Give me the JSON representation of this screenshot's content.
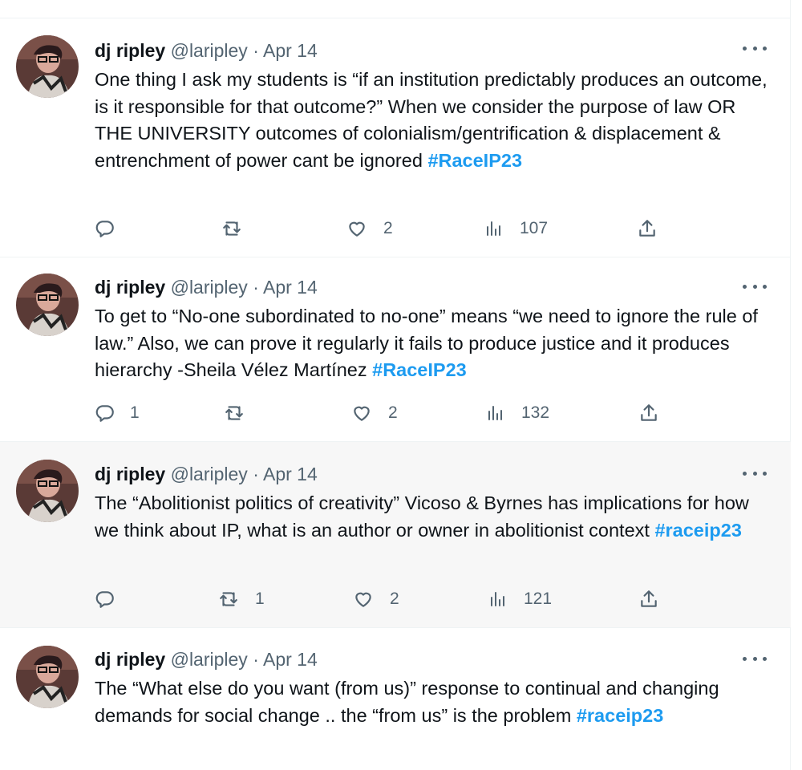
{
  "tweets": [
    {
      "name": "dj ripley",
      "handle": "@laripley",
      "dot": "·",
      "date": "Apr 14",
      "text": "One thing I ask my students is “if an institution predictably produces an outcome, is it responsible for that outcome?” When we consider the purpose of law OR THE UNIVERSITY outcomes of colonialism/gentrification & displacement & entrenchment of power cant be ignored ",
      "hashtag": "#RaceIP23",
      "replies": "",
      "retweets": "",
      "likes": "2",
      "views": "107"
    },
    {
      "name": "dj ripley",
      "handle": "@laripley",
      "dot": "·",
      "date": "Apr 14",
      "text": "To get to “No-one subordinated to no-one” means “we need to ignore the rule of law.” Also, we can prove it regularly it fails to produce justice and it produces hierarchy -Sheila Vélez Martínez ",
      "hashtag": "#RaceIP23",
      "replies": "1",
      "retweets": "",
      "likes": "2",
      "views": "132"
    },
    {
      "name": "dj ripley",
      "handle": "@laripley",
      "dot": "·",
      "date": "Apr 14",
      "text": "The “Abolitionist politics of creativity” Vicoso & Byrnes has implications for how we think about IP, what is an author or owner in abolitionist context ",
      "hashtag": "#raceip23",
      "replies": "",
      "retweets": "1",
      "likes": "2",
      "views": "121"
    },
    {
      "name": "dj ripley",
      "handle": "@laripley",
      "dot": "·",
      "date": "Apr 14",
      "text": "The “What else do you want (from us)” response to continual and changing demands for social change .. the “from us” is the problem ",
      "hashtag": "#raceip23"
    }
  ],
  "icons": {
    "reply": "reply-icon",
    "retweet": "retweet-icon",
    "like": "heart-icon",
    "views": "views-icon",
    "share": "share-icon",
    "more": "more-icon"
  },
  "colors": {
    "hashtag": "#1d9bf0",
    "secondary_text": "#536471",
    "hover_bg": "#f7f7f7"
  }
}
